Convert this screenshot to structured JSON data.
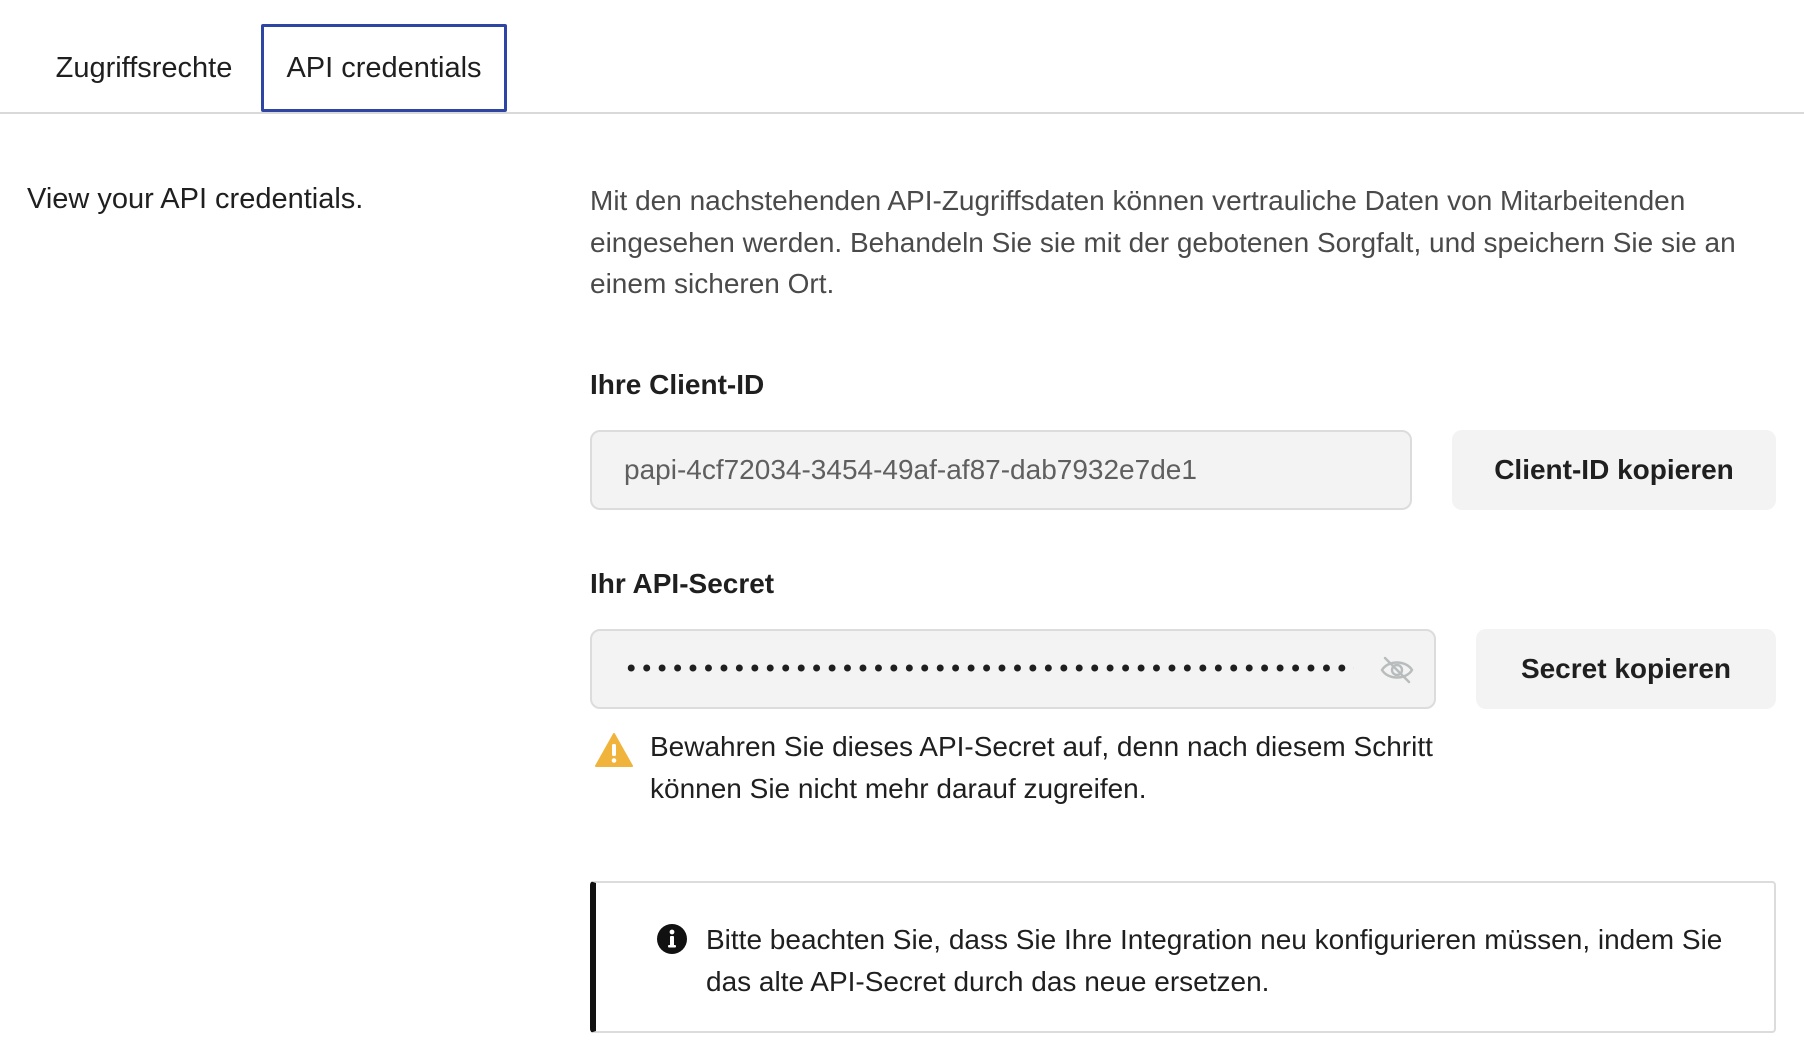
{
  "tabs": [
    {
      "label": "Zugriffsrechte",
      "active": false
    },
    {
      "label": "API credentials",
      "active": true
    }
  ],
  "section": {
    "description": "View your API credentials."
  },
  "intro_text": "Mit den nachstehenden API-Zugriffsdaten können vertrauliche Daten von Mitarbeitenden eingesehen werden. Behandeln Sie sie mit der gebotenen Sorgfalt, und speichern Sie sie an einem sicheren Ort.",
  "client_id": {
    "label": "Ihre Client-ID",
    "value": "papi-4cf72034-3454-49af-af87-dab7932e7de1",
    "copy_button": "Client-ID kopieren"
  },
  "api_secret": {
    "label": "Ihr API-Secret",
    "masked_value": "••••••••••••••••••••••••••••••••••••••••••••••••",
    "visibility_icon": "eye-off-icon",
    "copy_button": "Secret kopieren"
  },
  "warning": {
    "icon": "warning-triangle-icon",
    "text": "Bewahren Sie dieses API-Secret auf, denn nach diesem Schritt können Sie nicht mehr darauf zugreifen."
  },
  "info": {
    "icon": "info-icon",
    "text": "Bitte beachten Sie, dass Sie Ihre Integration neu konfigurieren müssen, indem Sie das alte API-Secret durch das neue ersetzen."
  },
  "colors": {
    "tab_focus_border": "#2f45a4",
    "warning": "#f0b43c",
    "field_background": "#f2f3f2"
  }
}
